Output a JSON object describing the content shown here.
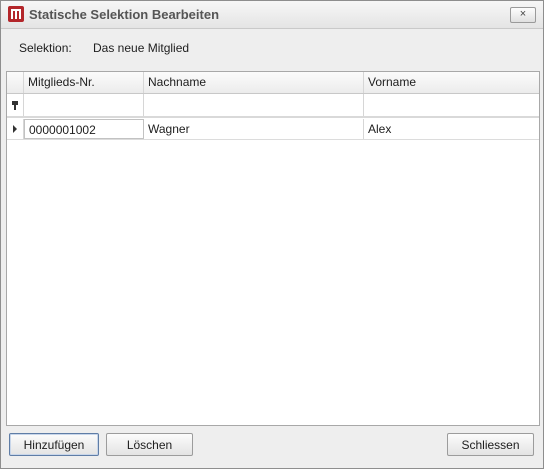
{
  "window": {
    "title": "Statische Selektion Bearbeiten",
    "close_glyph": "×"
  },
  "selection": {
    "label": "Selektion:",
    "value": "Das neue Mitglied"
  },
  "grid": {
    "columns": [
      "Mitglieds-Nr.",
      "Nachname",
      "Vorname"
    ],
    "rows": [
      {
        "member_no": "0000001002",
        "last_name": "Wagner",
        "first_name": "Alex"
      }
    ]
  },
  "buttons": {
    "add": "Hinzufügen",
    "delete": "Löschen",
    "close": "Schliessen"
  },
  "colors": {
    "app_icon": "#b3262a"
  },
  "icons": {
    "app": "app-logo-icon",
    "filter_row": "pin-icon",
    "current_row": "row-indicator-icon"
  }
}
